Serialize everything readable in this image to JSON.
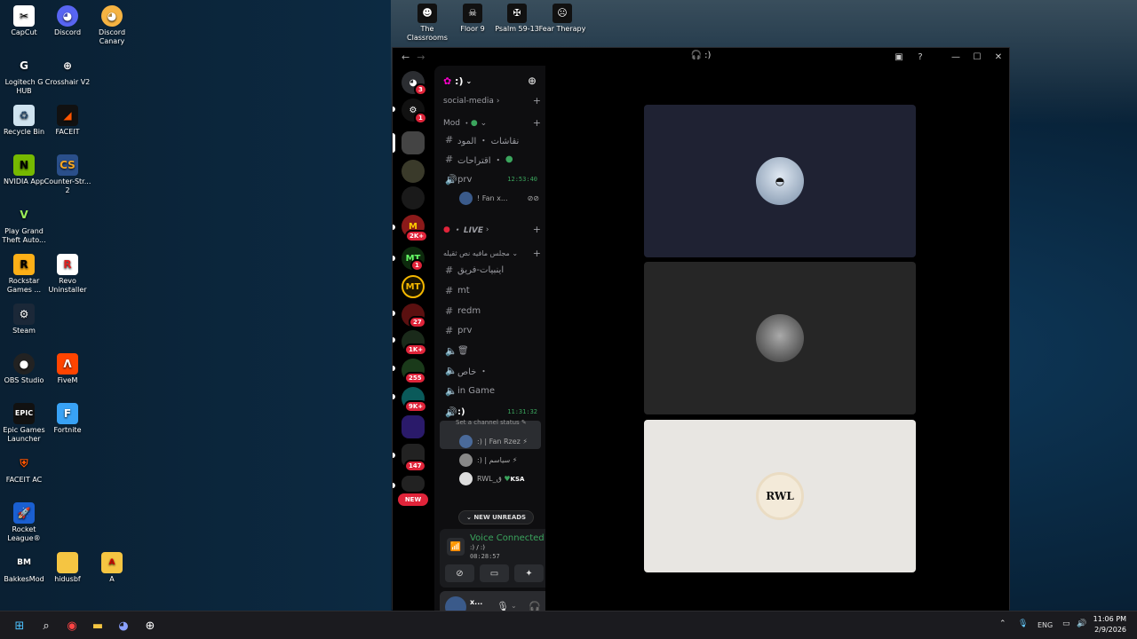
{
  "desktop": {
    "icons_col1": [
      "CapCut",
      "Logitech G HUB",
      "Recycle Bin",
      "NVIDIA App",
      "Play Grand Theft Auto...",
      "Rockstar Games ...",
      "Steam",
      "OBS Studio",
      "Epic Games Launcher",
      "FACEIT AC",
      "Rocket League®",
      "BakkesMod"
    ],
    "icons_col2": [
      "Discord",
      "Crosshair V2",
      "FACEIT",
      "Counter-Str... 2",
      "Revo Uninstaller",
      "FiveM",
      "Fortnite",
      "hidusbf",
      "A"
    ],
    "discord_canary": "Discord Canary",
    "top_shortcuts": [
      "The Classrooms",
      "Floor 9",
      "Psalm 59-13",
      "Fear Therapy"
    ]
  },
  "window": {
    "title": ":)",
    "controls": [
      "inbox-icon",
      "help-icon",
      "minimize",
      "maximize",
      "close"
    ]
  },
  "guilds": {
    "badges": [
      "3",
      "1",
      "2K+",
      "1",
      "27",
      "1K+",
      "255",
      "9K+",
      "147"
    ],
    "labels": [
      "MT",
      "MT"
    ],
    "new_label": "NEW"
  },
  "channels": {
    "server_name": ":)",
    "social_media": "social-media",
    "cat_mod": "Mod",
    "ch_discussions": "نقاشات ・ المود",
    "ch_suggestions": "اقتراحات ・",
    "prv_voice": "prv",
    "prv_time": "12:53:40",
    "prv_user": "! Fan x...",
    "live_cat": "・ LIVE",
    "cat_mafia": "مجلس مافيه نص ثقيله",
    "ch_tinbiyat": "اينبيات-فريق",
    "ch_mt": "mt",
    "ch_redm": "redm",
    "ch_prv": "prv",
    "ch_trash": "🗑",
    "ch_private": "خاص ・",
    "ch_ingame": "in Game",
    "active_channel": ":)",
    "active_time": "11:31:32",
    "set_status": "Set a channel status",
    "voice_users": [
      ":) | Fan Rzez",
      ":) | سياسم",
      "RWL_ق"
    ],
    "user_tag": "KSA",
    "new_unreads": "NEW UNREADS"
  },
  "voice": {
    "status": "Voice Connected",
    "sub": ":) / :)",
    "time": "08:28:57"
  },
  "user_panel": {
    "name": "x..."
  },
  "stage": {
    "tile_colors": [
      "#1f2233",
      "#262626",
      "#e8e6e2"
    ],
    "tile3_logo": "RWL"
  },
  "taskbar": {
    "lang": "ENG",
    "time": "11:06 PM",
    "date": "2/9/2026"
  }
}
